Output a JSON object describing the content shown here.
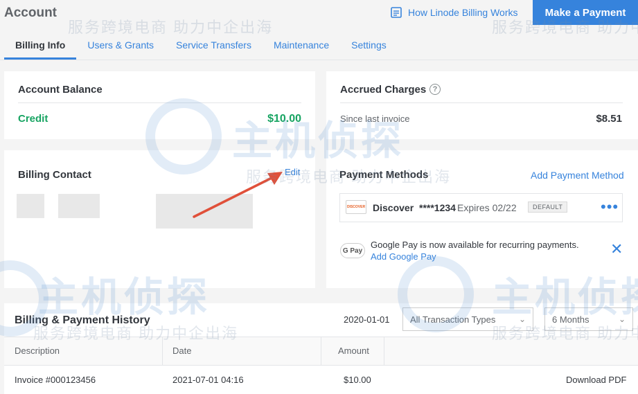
{
  "header": {
    "title": "Account",
    "docs_link": "How Linode Billing Works",
    "make_payment": "Make a Payment"
  },
  "tabs": [
    {
      "label": "Billing Info",
      "active": true
    },
    {
      "label": "Users & Grants",
      "active": false
    },
    {
      "label": "Service Transfers",
      "active": false
    },
    {
      "label": "Maintenance",
      "active": false
    },
    {
      "label": "Settings",
      "active": false
    }
  ],
  "account_balance": {
    "title": "Account Balance",
    "label": "Credit",
    "amount": "$10.00"
  },
  "accrued_charges": {
    "title": "Accrued Charges",
    "label": "Since last invoice",
    "amount": "$8.51"
  },
  "billing_contact": {
    "title": "Billing Contact",
    "edit": "Edit"
  },
  "payment_methods": {
    "title": "Payment Methods",
    "add": "Add Payment Method",
    "card": {
      "brand": "Discover",
      "number": "****1234",
      "expires": "Expires 02/22",
      "badge": "DEFAULT",
      "logo_text": "DISCOVER"
    },
    "gpay_icon_text": "G Pay",
    "gpay_notice": "Google Pay is now available for recurring payments.",
    "gpay_link": "Add Google Pay"
  },
  "history": {
    "title": "Billing & Payment History",
    "date_filter": "2020-01-01",
    "type_select": "All Transaction Types",
    "range_select": "6 Months",
    "columns": [
      "Description",
      "Date",
      "Amount"
    ],
    "rows": [
      {
        "description": "Invoice #000123456",
        "date": "2021-07-01 04:16",
        "amount": "$10.00",
        "action": "Download PDF"
      }
    ]
  },
  "watermarks": {
    "small": "服务跨境电商  助力中企出海",
    "big": "主机侦探"
  },
  "colors": {
    "accent": "#3683dc",
    "credit_green": "#17a462",
    "arrow_red": "#e0503a"
  }
}
